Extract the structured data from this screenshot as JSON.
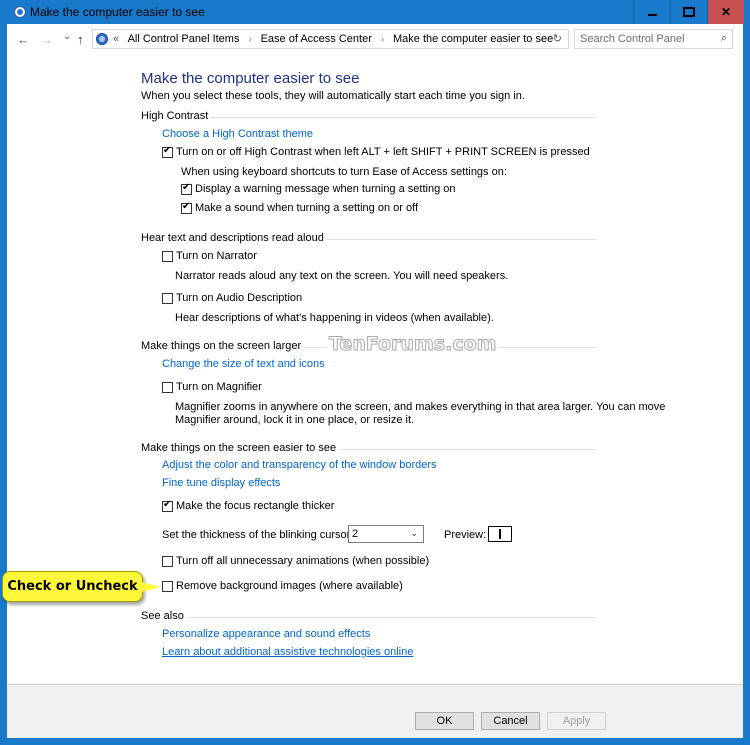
{
  "window": {
    "title": "Make the computer easier to see",
    "controls": {
      "minimize": "minimize",
      "maximize": "maximize",
      "close": "close"
    }
  },
  "nav": {
    "back_icon": "←",
    "forward_icon": "→",
    "recent_icon": "⌄",
    "up_icon": "↑",
    "breadcrumb_prefix": "«",
    "breadcrumbs": [
      "All Control Panel Items",
      "Ease of Access Center",
      "Make the computer easier to see"
    ],
    "separator": "›",
    "dropdown_icon": "⌄",
    "refresh_icon": "↻",
    "search_placeholder": "Search Control Panel",
    "search_icon": "⚲"
  },
  "main": {
    "title": "Make the computer easier to see",
    "subtitle": "When you select these tools, they will automatically start each time you sign in.",
    "sections": {
      "high_contrast": {
        "heading": "High Contrast",
        "link": "Choose a High Contrast theme",
        "toggle_shortcut": {
          "label": "Turn on or off High Contrast when left ALT + left SHIFT + PRINT SCREEN is pressed",
          "checked": true
        },
        "shortcut_note": "When using keyboard shortcuts to turn Ease of Access settings on:",
        "warning_message": {
          "label": "Display a warning message when turning a setting on",
          "checked": true
        },
        "sound": {
          "label": "Make a sound when turning a setting on or off",
          "checked": true
        }
      },
      "read_aloud": {
        "heading": "Hear text and descriptions read aloud",
        "narrator": {
          "label": "Turn on Narrator",
          "checked": false,
          "description": "Narrator reads aloud any text on the screen. You will need speakers."
        },
        "audio_description": {
          "label": "Turn on Audio Description",
          "checked": false,
          "description": "Hear descriptions of what's happening in videos (when available)."
        }
      },
      "larger": {
        "heading": "Make things on the screen larger",
        "link": "Change the size of text and icons",
        "magnifier": {
          "label": "Turn on Magnifier",
          "checked": false,
          "description_line1": "Magnifier zooms in anywhere on the screen, and makes everything in that area larger. You can move",
          "description_line2": "Magnifier around, lock it in one place, or resize it."
        }
      },
      "easier": {
        "heading": "Make things on the screen easier to see",
        "link1": "Adjust the color and transparency of the window borders",
        "link2": "Fine tune display effects",
        "focus_rect": {
          "label": "Make the focus rectangle thicker",
          "checked": true
        },
        "cursor_thickness_label": "Set the thickness of the blinking cursor:",
        "cursor_thickness_value": "2",
        "preview_label": "Preview:",
        "animations": {
          "label": "Turn off all unnecessary animations (when possible)",
          "checked": false
        },
        "background_images": {
          "label": "Remove background images (where available)",
          "checked": false
        }
      },
      "see_also": {
        "heading": "See also",
        "link1": "Personalize appearance and sound effects",
        "link2": "Learn about additional assistive technologies online"
      }
    }
  },
  "watermark": "TenForums.com",
  "callout": "Check or Uncheck",
  "footer": {
    "ok": "OK",
    "cancel": "Cancel",
    "apply": "Apply"
  }
}
